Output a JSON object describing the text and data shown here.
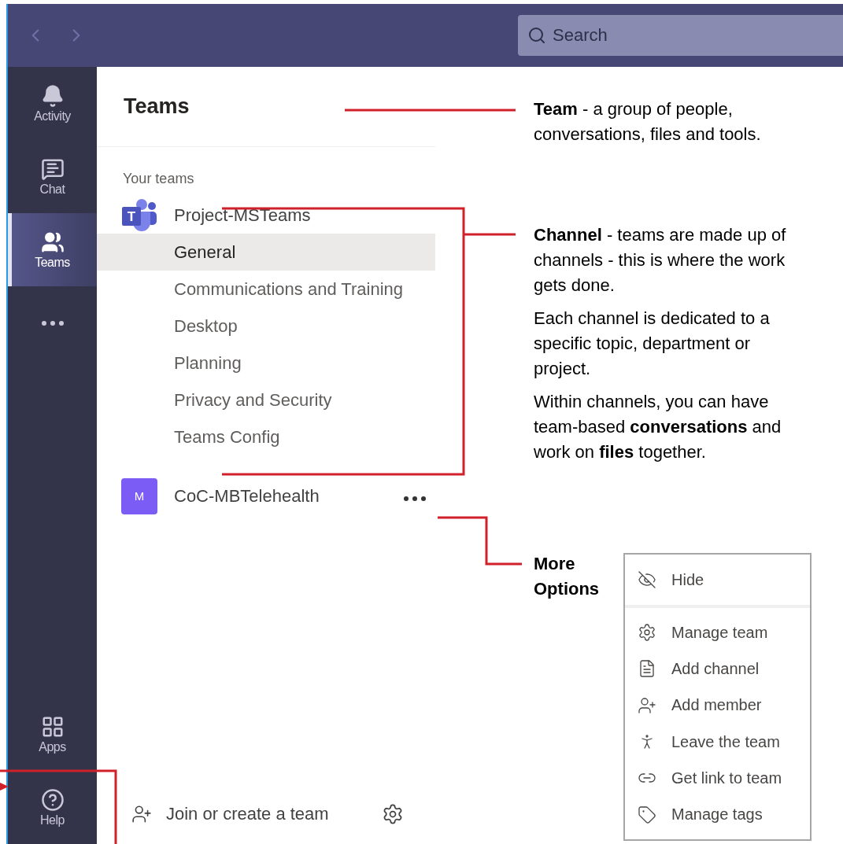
{
  "search": {
    "placeholder": "Search"
  },
  "rail": [
    {
      "kind": "activity",
      "label": "Activity",
      "selected": false
    },
    {
      "kind": "chat",
      "label": "Chat",
      "selected": false
    },
    {
      "kind": "teams",
      "label": "Teams",
      "selected": true
    },
    {
      "kind": "more",
      "selected": false
    }
  ],
  "rail_bottom": [
    {
      "kind": "apps",
      "label": "Apps",
      "selected": false
    },
    {
      "kind": "help",
      "label": "Help",
      "selected": false
    }
  ],
  "panel": {
    "title": "Teams",
    "section": "Your teams",
    "teams": [
      {
        "name": "Project-MSTeams",
        "avatar": {
          "kind": "logo",
          "letter": "T"
        },
        "more": false,
        "channels": [
          {
            "name": "General",
            "selected": true
          },
          {
            "name": "Communications and Training",
            "selected": false
          },
          {
            "name": "Desktop",
            "selected": false
          },
          {
            "name": "Planning",
            "selected": false
          },
          {
            "name": "Privacy and Security",
            "selected": false
          },
          {
            "name": "Teams Config",
            "selected": false
          }
        ]
      },
      {
        "name": "CoC-MBTelehealth",
        "avatar": {
          "kind": "initial",
          "letter": "M",
          "color": "#7b5cf5"
        },
        "more": true
      }
    ],
    "footer": "Join or create a team"
  },
  "annotations": [
    {
      "kind": "team",
      "paragraphs": [
        "**Team** - a group of people, conversations, files and tools."
      ]
    },
    {
      "kind": "channels",
      "paragraphs": [
        "**Channel** - teams are made up of channels - this is where the work gets done.",
        "Each channel is dedicated to a specific topic, department or project.",
        "Within channels, you can have team-based **conversations** and work on **files** together."
      ]
    },
    {
      "kind": "more",
      "paragraphs": [
        "**More Options**"
      ]
    }
  ],
  "menu": [
    {
      "kind": "hide",
      "label": "Hide"
    },
    {
      "kind": "manage",
      "label": "Manage team"
    },
    {
      "kind": "channel",
      "label": "Add channel"
    },
    {
      "kind": "member",
      "label": "Add member"
    },
    {
      "kind": "leave",
      "label": "Leave the team"
    },
    {
      "kind": "link",
      "label": "Get link to team"
    },
    {
      "kind": "tags",
      "label": "Manage tags"
    }
  ]
}
